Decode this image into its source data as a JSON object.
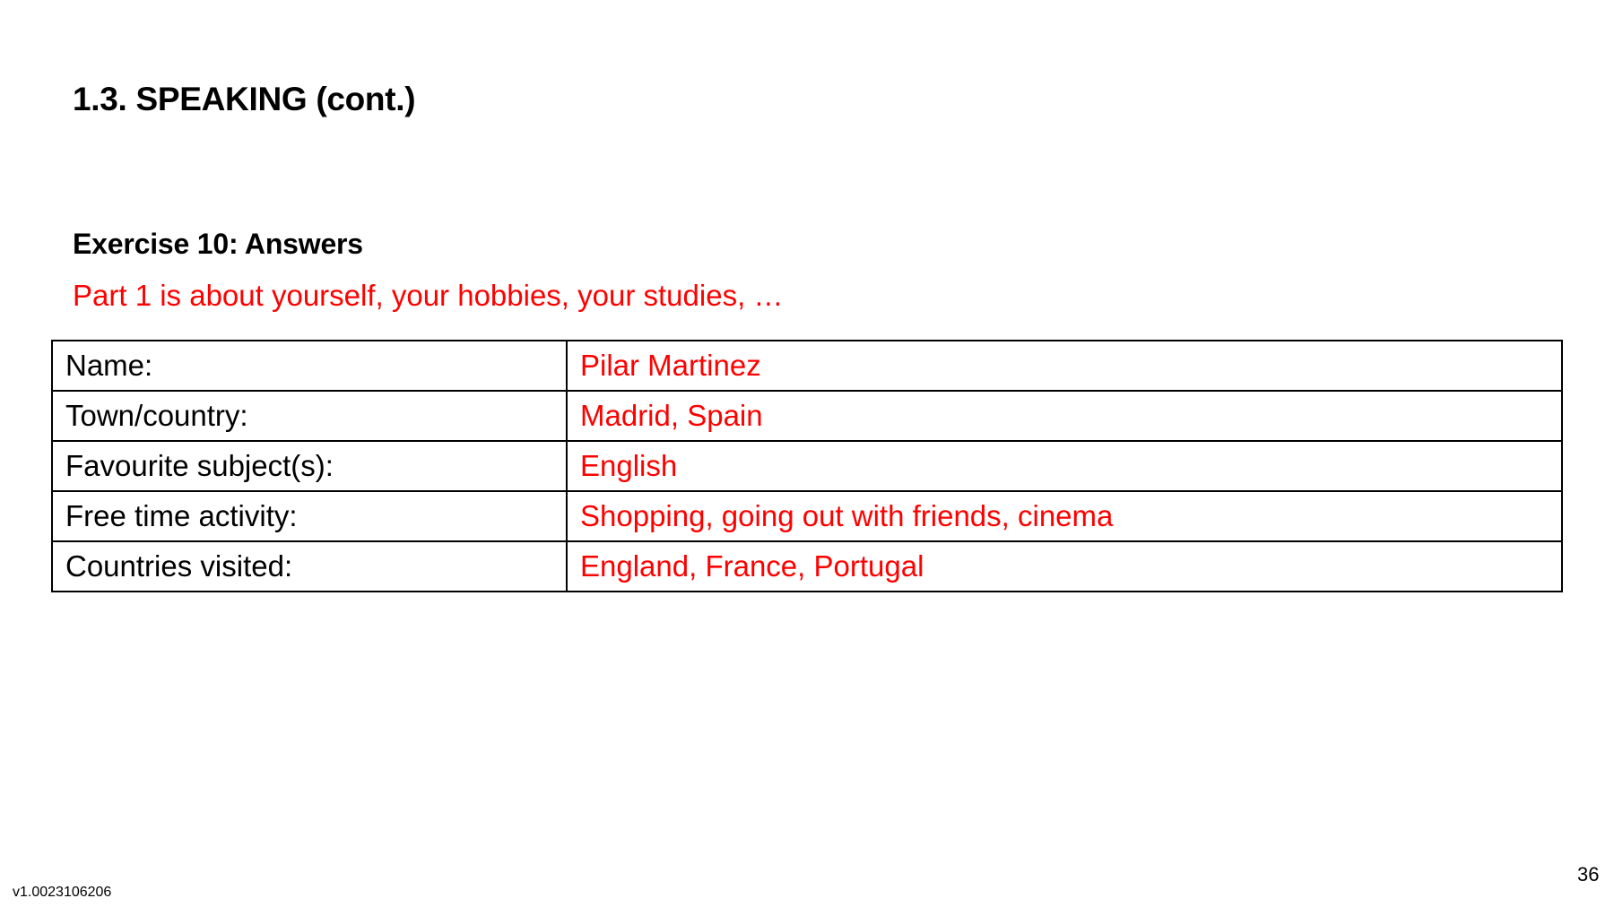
{
  "title": "1.3. SPEAKING (cont.)",
  "heading": "Exercise 10: Answers",
  "subtitle": "Part 1 is about yourself, your hobbies, your studies, …",
  "table": {
    "rows": [
      {
        "label": "Name:",
        "value": "Pilar Martinez"
      },
      {
        "label": "Town/country:",
        "value": "Madrid, Spain"
      },
      {
        "label": "Favourite subject(s):",
        "value": "English"
      },
      {
        "label": "Free time activity:",
        "value": "Shopping, going out with friends, cinema"
      },
      {
        "label": "Countries visited:",
        "value": "England, France, Portugal"
      }
    ]
  },
  "footer": {
    "version": "v1.0023106206",
    "page_number": "36"
  },
  "colors": {
    "answer": "#ff0000",
    "text": "#000000"
  }
}
